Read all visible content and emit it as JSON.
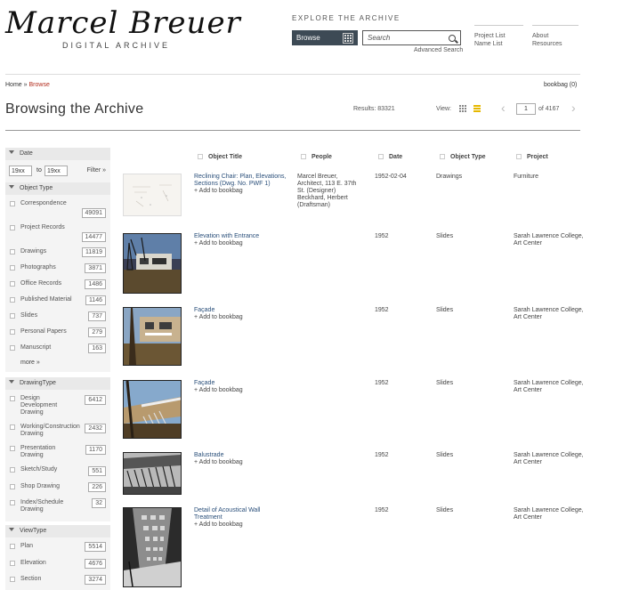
{
  "header": {
    "logo_text": "Marcel Breuer",
    "logo_sub": "DIGITAL ARCHIVE",
    "explore": "EXPLORE THE ARCHIVE",
    "browse": "Browse",
    "search_placeholder": "Search",
    "advanced_search": "Advanced Search",
    "nav": [
      {
        "line1": "Project List",
        "line2": "Name List"
      },
      {
        "line1": "About",
        "line2": "Resources"
      }
    ]
  },
  "breadcrumb": {
    "home": "Home",
    "sep": "»",
    "current": "Browse"
  },
  "bookbag": "bookbag (0)",
  "page": {
    "title": "Browsing the Archive",
    "results": "Results: 83321",
    "view_label": "View:",
    "current_page": "1",
    "of_pages": "of 4167"
  },
  "sidebar": {
    "date": {
      "label": "Date",
      "from": "19xx",
      "to_label": "to",
      "to": "19xx",
      "filter": "Filter »"
    },
    "object_type": {
      "label": "Object Type",
      "items": [
        {
          "label": "Correspondence",
          "count": "49091"
        },
        {
          "label": "Project Records",
          "count": "14477"
        },
        {
          "label": "Drawings",
          "count": "11819"
        },
        {
          "label": "Photographs",
          "count": "3871"
        },
        {
          "label": "Office Records",
          "count": "1486"
        },
        {
          "label": "Published Material",
          "count": "1146"
        },
        {
          "label": "Slides",
          "count": "737"
        },
        {
          "label": "Personal Papers",
          "count": "279"
        },
        {
          "label": "Manuscript",
          "count": "163"
        }
      ],
      "more": "more »"
    },
    "drawing_type": {
      "label": "DrawingType",
      "items": [
        {
          "label": "Design Development Drawing",
          "count": "6412"
        },
        {
          "label": "Working/Construction Drawing",
          "count": "2432"
        },
        {
          "label": "Presentation Drawing",
          "count": "1170"
        },
        {
          "label": "Sketch/Study",
          "count": "551"
        },
        {
          "label": "Shop Drawing",
          "count": "226"
        },
        {
          "label": "Index/Schedule Drawing",
          "count": "32"
        }
      ]
    },
    "view_type": {
      "label": "ViewType",
      "items": [
        {
          "label": "Plan",
          "count": "5514"
        },
        {
          "label": "Elevation",
          "count": "4676"
        },
        {
          "label": "Section",
          "count": "3274"
        }
      ]
    }
  },
  "table": {
    "headers": {
      "title": "Object Title",
      "people": "People",
      "date": "Date",
      "type": "Object Type",
      "project": "Project"
    },
    "add_label": "+ Add to bookbag",
    "rows": [
      {
        "title": "Reclining Chair: Plan, Elevations, Sections (Dwg. No. PWF 1)",
        "people": "Marcel Breuer, Architect, 113 E. 37th St. (Designer) Beckhard, Herbert (Draftsman)",
        "date": "1952-02-04",
        "type": "Drawings",
        "project": "Furniture",
        "thumb": "paper-drawing"
      },
      {
        "title": "Elevation with Entrance",
        "people": "",
        "date": "1952",
        "type": "Slides",
        "project": "Sarah Lawrence College, Art Center",
        "thumb": "building-photo"
      },
      {
        "title": "Façade",
        "people": "",
        "date": "1952",
        "type": "Slides",
        "project": "Sarah Lawrence College, Art Center",
        "thumb": "facade-photo"
      },
      {
        "title": "Façade",
        "people": "",
        "date": "1952",
        "type": "Slides",
        "project": "Sarah Lawrence College, Art Center",
        "thumb": "facade-photo-2"
      },
      {
        "title": "Balustrade",
        "people": "",
        "date": "1952",
        "type": "Slides",
        "project": "Sarah Lawrence College, Art Center",
        "thumb": "balustrade-photo"
      },
      {
        "title": "Detail of Acoustical Wall Treatment",
        "people": "",
        "date": "1952",
        "type": "Slides",
        "project": "Sarah Lawrence College, Art Center",
        "thumb": "wall-photo"
      }
    ]
  }
}
